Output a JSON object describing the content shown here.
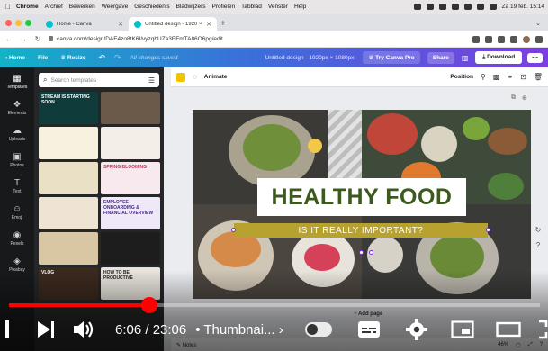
{
  "macos_menubar": {
    "items": [
      "Chrome",
      "Archief",
      "Bewerken",
      "Weergave",
      "Geschiedenis",
      "Bladwijzers",
      "Profielen",
      "Tabblad",
      "Venster",
      "Help"
    ],
    "clock": "Za 19 feb. 15:14"
  },
  "browser": {
    "tabs": [
      {
        "label": "Home - Canva"
      },
      {
        "label": "Untitled design - 1920 × 1080"
      }
    ],
    "url": "canva.com/design/DAE4zo8tK6I/vyzqhUZa3EFmTA86O6pg/edit"
  },
  "canva_topbar": {
    "home": "Home",
    "file": "File",
    "resize": "Resize",
    "saved_status": "All changes saved",
    "design_title": "Untitled design - 1920px × 1080px",
    "try_pro": "Try Canva Pro",
    "share": "Share",
    "download": "Download",
    "more": "•••"
  },
  "rail": {
    "items": [
      {
        "label": "Templates",
        "icon": "templates-icon"
      },
      {
        "label": "Elements",
        "icon": "elements-icon"
      },
      {
        "label": "Uploads",
        "icon": "uploads-icon"
      },
      {
        "label": "Photos",
        "icon": "photos-icon"
      },
      {
        "label": "Text",
        "icon": "text-icon"
      },
      {
        "label": "Emoji",
        "icon": "emoji-icon"
      },
      {
        "label": "Pexels",
        "icon": "pexels-icon"
      },
      {
        "label": "Pixabay",
        "icon": "pixabay-icon"
      }
    ]
  },
  "panel": {
    "search_placeholder": "Search templates",
    "templates": [
      {
        "text": "STREAM IS STARTING SOON",
        "bg": "#0f3b3a",
        "fg": "#ffffff"
      },
      {
        "text": "",
        "bg": "#6b5a4a",
        "fg": "#ffffff"
      },
      {
        "text": "",
        "bg": "#f6f2df",
        "fg": "#333333"
      },
      {
        "text": "",
        "bg": "#f3eee8",
        "fg": "#333333"
      },
      {
        "text": "",
        "bg": "#e9e0c6",
        "fg": "#333333"
      },
      {
        "text": "SPRING BLOOMING",
        "bg": "#f7e9ee",
        "fg": "#c0395a"
      },
      {
        "text": "",
        "bg": "#efe4d3",
        "fg": "#333333"
      },
      {
        "text": "EMPLOYEE ONBOARDING & FINANCIAL OVERVIEW",
        "bg": "#efe8f8",
        "fg": "#4a2b82"
      },
      {
        "text": "",
        "bg": "#d8c7a2",
        "fg": "#333333"
      },
      {
        "text": "",
        "bg": "#1d1d1d",
        "fg": "#ffffff"
      },
      {
        "text": "VLOG",
        "bg": "#3b2a1e",
        "fg": "#ffffff"
      },
      {
        "text": "HOW TO BE PRODUCTIVE",
        "bg": "#e8e4dc",
        "fg": "#222222"
      }
    ]
  },
  "editor": {
    "animate": "Animate",
    "position": "Position",
    "headline": "HEALTHY FOOD",
    "subline": "IS IT REALLY IMPORTANT?",
    "add_page": "+ Add page",
    "notes": "Notes",
    "zoom": "46%"
  },
  "player": {
    "time": "6:06 / 23:06",
    "chapter": "• Thumbnai... ›",
    "progress": 0.265
  },
  "colors": {
    "headline": "#3c5a1e",
    "subline_bg": "#b7a230",
    "progress": "#ff0000",
    "accent": "#7d2ae8"
  }
}
